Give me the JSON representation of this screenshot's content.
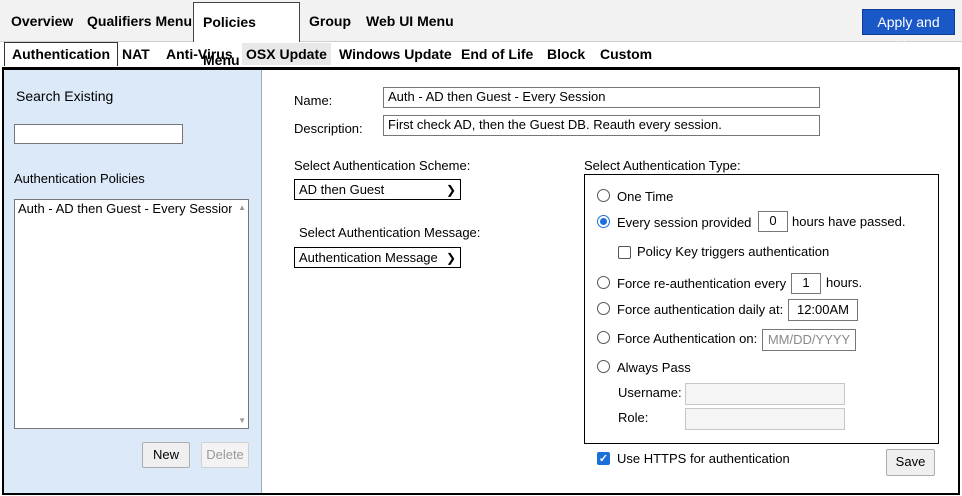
{
  "top_menu": {
    "overview": "Overview",
    "qualifiers": "Qualifiers Menu",
    "policies": "Policies Menu",
    "group": "Group",
    "webui": "Web UI Menu",
    "apply": "Apply and Use"
  },
  "sub_tabs": {
    "authentication": "Authentication",
    "nat": "NAT",
    "antivirus": "Anti-Virus",
    "osx": "OSX Update",
    "windows": "Windows Update",
    "eol": "End of Life",
    "block": "Block",
    "custom": "Custom"
  },
  "left": {
    "search_label": "Search Existing",
    "search_value": "",
    "policies_label": "Authentication Policies",
    "policies": [
      "Auth - AD then Guest - Every Session"
    ],
    "new_button": "New",
    "delete_button": "Delete"
  },
  "form": {
    "name_label": "Name:",
    "name_value": "Auth - AD then Guest - Every Session",
    "desc_label": "Description:",
    "desc_value": "First check AD, then the Guest DB. Reauth every session.",
    "scheme_label": "Select Authentication Scheme:",
    "scheme_value": "AD then Guest",
    "message_label": "Select Authentication Message:",
    "message_value": "Authentication Message",
    "type_label": "Select Authentication Type:",
    "one_time": "One Time",
    "every_session": "Every session provided",
    "every_session_hours": "0",
    "hours_have_passed": "hours have passed.",
    "policy_key": "Policy Key triggers authentication",
    "force_reauth": "Force re-authentication every",
    "force_reauth_hours": "1",
    "hours": "hours.",
    "force_daily": "Force authentication daily at:",
    "force_daily_time": "12:00AM",
    "force_on": "Force Authentication on:",
    "force_on_placeholder": "MM/DD/YYYY",
    "always_pass": "Always Pass",
    "username_label": "Username:",
    "role_label": "Role:",
    "https_label": "Use HTTPS for authentication",
    "save_button": "Save"
  },
  "colors": {
    "accent": "#1a58c8",
    "left_pane_bg": "#dbe9f8",
    "radio_checked": "#1a6fd9"
  }
}
